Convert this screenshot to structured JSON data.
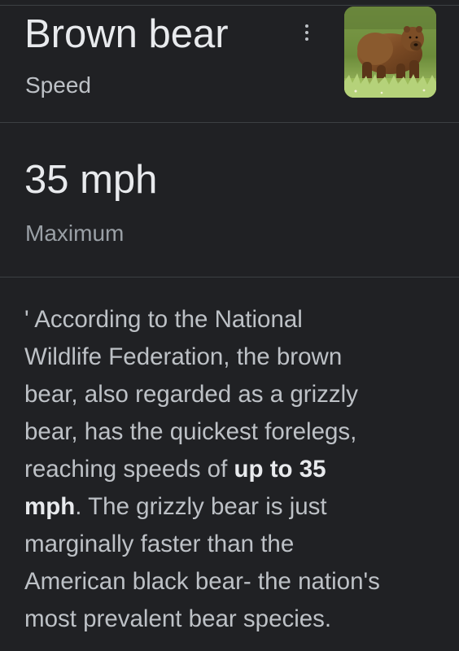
{
  "header": {
    "title": "Brown bear",
    "subtitle": "Speed",
    "more_icon": "more-vert-icon",
    "image_subject": "brown bear standing in grass"
  },
  "answer": {
    "value": "35 mph",
    "label": "Maximum"
  },
  "snippet": {
    "lines": [
      [
        "' According to the National"
      ],
      [
        "Wildlife Federation, the brown"
      ],
      [
        "bear, also regarded as a grizzly"
      ],
      [
        "bear, has the quickest forelegs,"
      ],
      [
        "reaching speeds of ",
        "up to 35"
      ],
      [
        "mph",
        ". The grizzly bear is just"
      ],
      [
        "marginally faster than the"
      ],
      [
        "American black bear- the nation's"
      ],
      [
        "most prevalent bear species."
      ]
    ]
  },
  "colors": {
    "background": "#202124",
    "primary_text": "#e8eaed",
    "secondary_text": "#bdc1c6",
    "divider": "#3c4043"
  }
}
